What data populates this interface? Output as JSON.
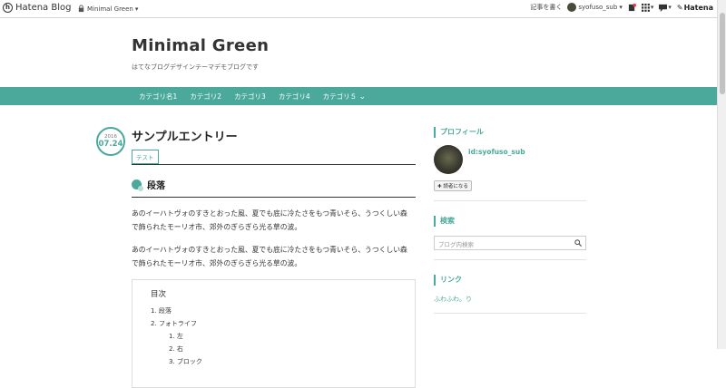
{
  "topbar": {
    "brand": "Hatena Blog",
    "blog_selector": "Minimal Green",
    "write_entry": "記事を書く",
    "user": "syofuso_sub",
    "hatena": "Hatena"
  },
  "blog": {
    "title": "Minimal Green",
    "description": "はてなブログデザインテーマデモブログです"
  },
  "nav": {
    "items": [
      "カテゴリ名1",
      "カテゴリ2",
      "カテゴリ3",
      "カテゴリ4",
      "カテゴリ５"
    ]
  },
  "entry": {
    "date_year": "2016",
    "date_md": "07.24",
    "title": "サンプルエントリー",
    "category": "テスト",
    "section_title": "段落",
    "para1_line1": "あのイーハトヴォのすきとおった風、夏でも底に冷たさをもつ青いそら、うつくしい森",
    "para1_line2": "で飾られたモーリオ市、郊外のぎらぎら光る草の波。",
    "para2_line1": "あのイーハトヴォのすきとおった風、夏でも底に冷たさをもつ青いそら、うつくしい森",
    "para2_line2": "で飾られたモーリオ市、郊外のぎらぎら光る草の波。",
    "toc": {
      "title": "目次",
      "items": [
        "1. 段落",
        "2. フォトライフ"
      ],
      "subitems": [
        "1. 左",
        "2. 右",
        "3. ブロック"
      ]
    }
  },
  "sidebar": {
    "profile_title": "プロフィール",
    "profile_id": "id:syofuso_sub",
    "reader_button": "読者になる",
    "search_title": "検索",
    "search_placeholder": "ブログ内検索",
    "links_title": "リンク",
    "link1": "ふわふわ。り"
  },
  "colors": {
    "accent": "#4aa99a"
  }
}
